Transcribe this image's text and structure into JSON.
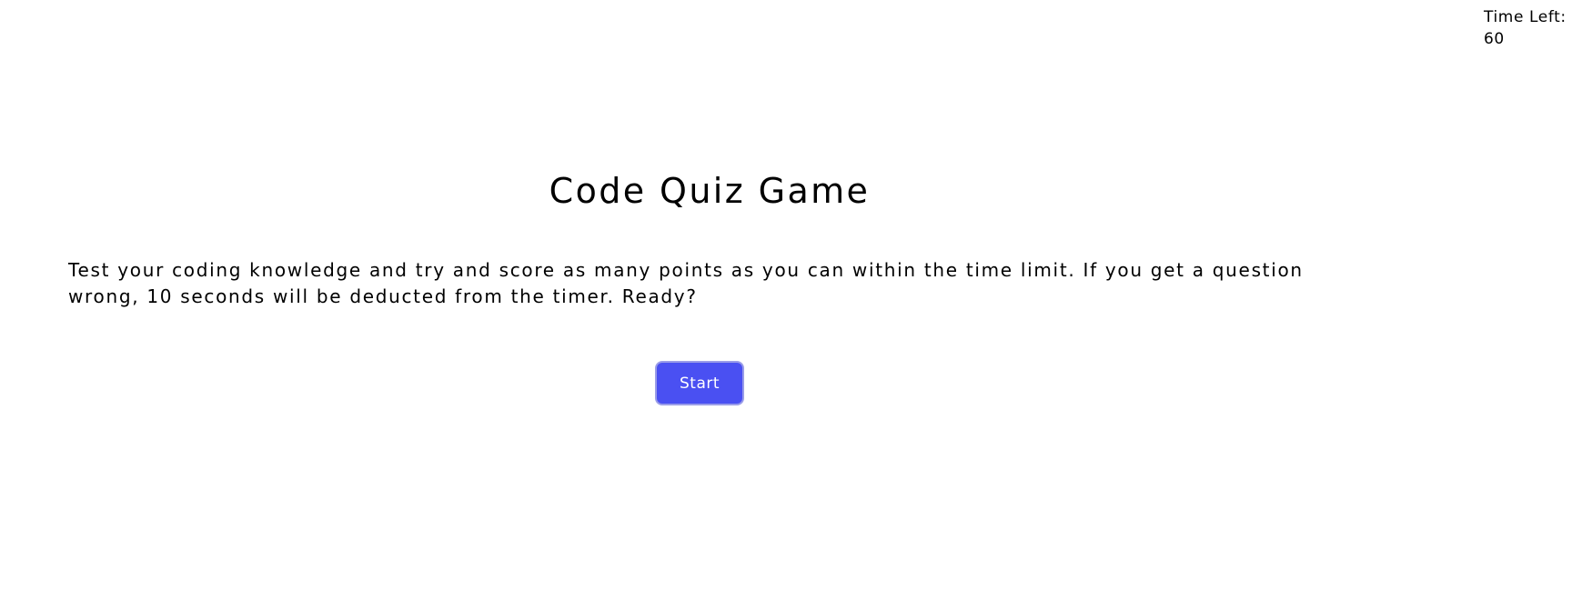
{
  "timer": {
    "label": "Time Left:",
    "value": "60"
  },
  "main": {
    "title": "Code Quiz Game",
    "intro": "Test your coding knowledge and try and score as many points as you can within the time limit. If you get a question wrong, 10 seconds will be deducted from the timer. Ready?",
    "start_label": "Start"
  },
  "colors": {
    "background": "#ffffff",
    "text": "#000000",
    "button_bg": "#4a50f2",
    "button_border": "#9a9de8",
    "button_text": "#ffffff"
  }
}
